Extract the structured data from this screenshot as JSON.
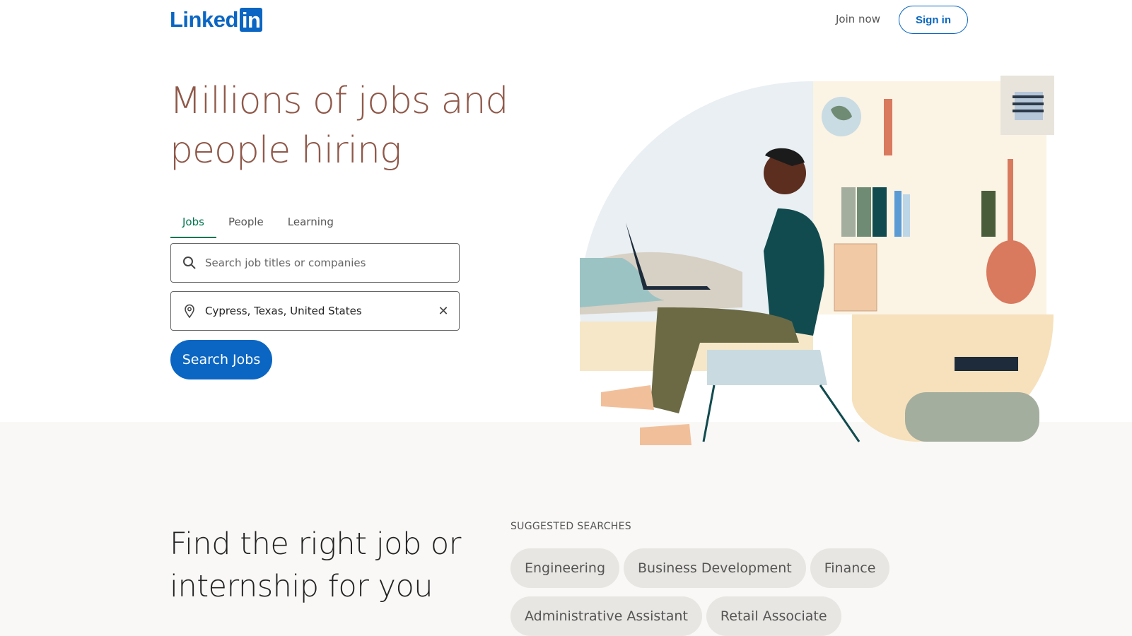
{
  "header": {
    "logo_text": "Linked",
    "logo_box": "in",
    "join_now": "Join now",
    "sign_in": "Sign in"
  },
  "hero": {
    "title": "Millions of jobs and people hiring"
  },
  "tabs": [
    {
      "label": "Jobs",
      "active": true
    },
    {
      "label": "People",
      "active": false
    },
    {
      "label": "Learning",
      "active": false
    }
  ],
  "search": {
    "keywords_placeholder": "Search job titles or companies",
    "keywords_value": "",
    "location_value": "Cypress, Texas, United States",
    "button": "Search Jobs"
  },
  "icons": {
    "search": "search-icon",
    "location": "map-pin-icon",
    "clear": "close-icon"
  },
  "section": {
    "title": "Find the right job or internship for you",
    "suggested_label": "SUGGESTED SEARCHES",
    "pills": [
      "Engineering",
      "Business Development",
      "Finance",
      "Administrative Assistant",
      "Retail Associate"
    ]
  },
  "colors": {
    "brand": "#0a66c2",
    "title": "#8f5849",
    "tab_active": "#01754f"
  }
}
